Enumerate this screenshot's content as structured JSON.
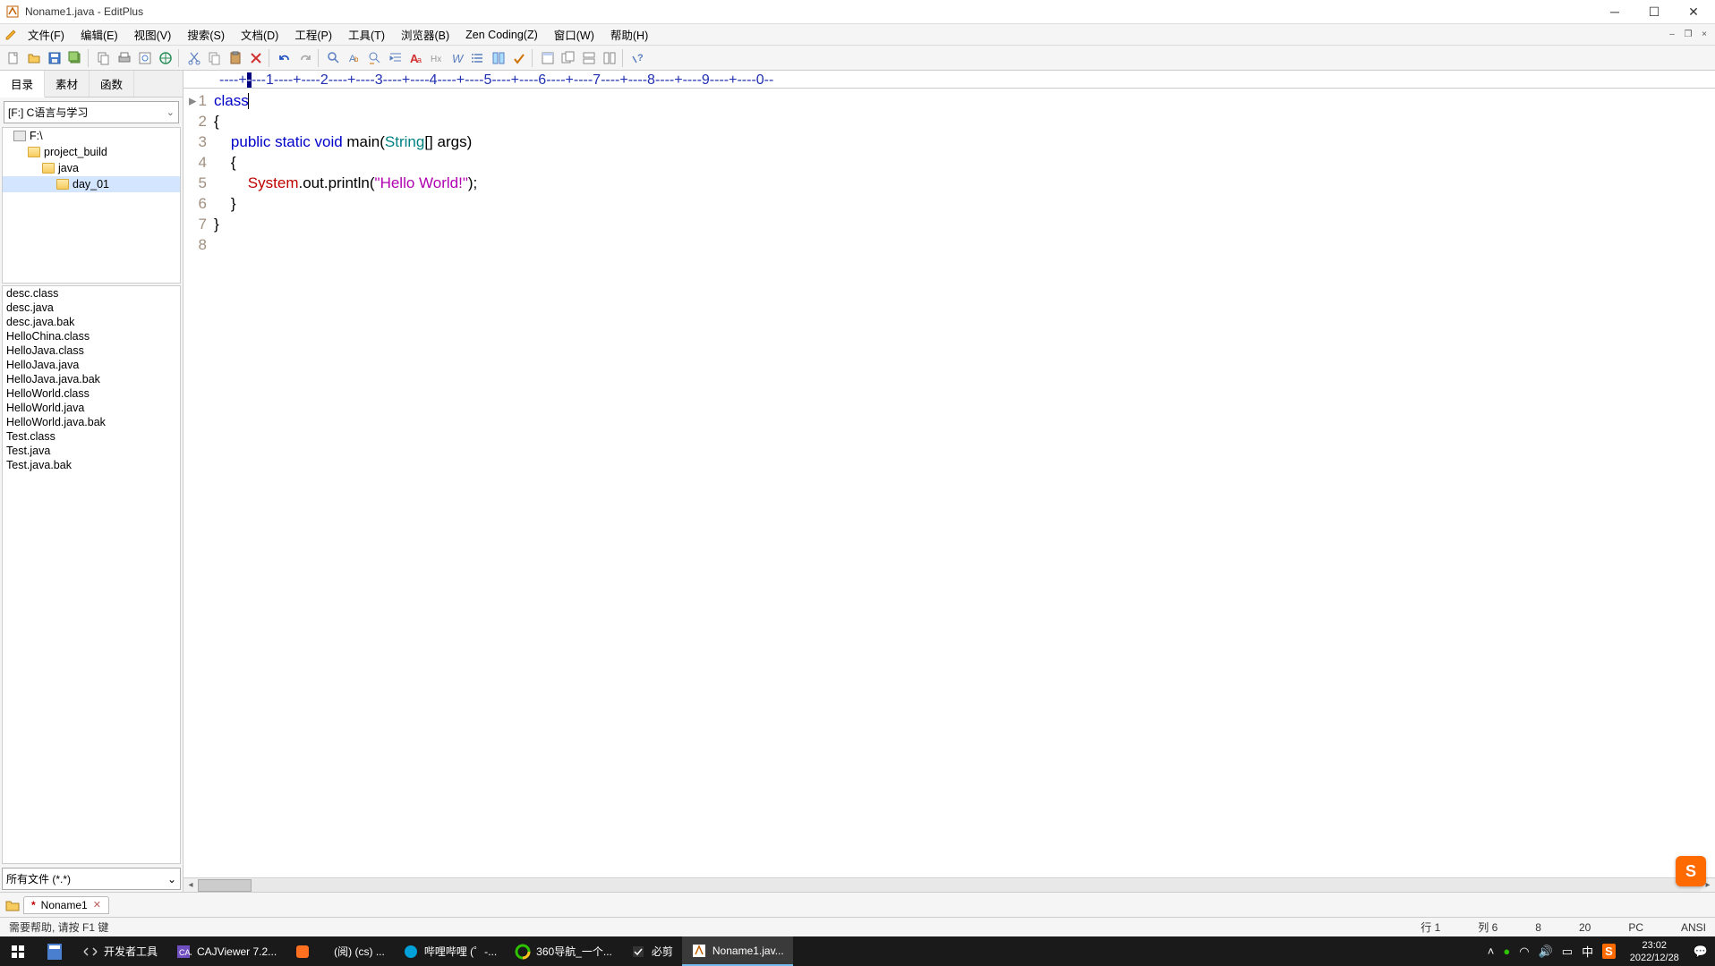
{
  "window": {
    "title": "Noname1.java - EditPlus"
  },
  "menu": {
    "file": "文件(F)",
    "edit": "编辑(E)",
    "view": "视图(V)",
    "search": "搜索(S)",
    "document": "文档(D)",
    "project": "工程(P)",
    "tools": "工具(T)",
    "browser": "浏览器(B)",
    "zen": "Zen Coding(Z)",
    "window": "窗口(W)",
    "help": "帮助(H)"
  },
  "sidebar": {
    "tabs": {
      "dir": "目录",
      "clip": "素材",
      "func": "函数"
    },
    "drive_label": "[F:] C语言与学习",
    "tree": [
      {
        "label": "F:\\",
        "indent": 0,
        "type": "drive"
      },
      {
        "label": "project_build",
        "indent": 1,
        "type": "folder"
      },
      {
        "label": "java",
        "indent": 2,
        "type": "folder"
      },
      {
        "label": "day_01",
        "indent": 3,
        "type": "folder",
        "selected": true
      }
    ],
    "files": [
      "desc.class",
      "desc.java",
      "desc.java.bak",
      "HelloChina.class",
      "HelloJava.class",
      "HelloJava.java",
      "HelloJava.java.bak",
      "HelloWorld.class",
      "HelloWorld.java",
      "HelloWorld.java.bak",
      "Test.class",
      "Test.java",
      "Test.java.bak"
    ],
    "filter": "所有文件 (*.*)"
  },
  "ruler": {
    "pre": "----+",
    "mark": "-",
    "post": "---1----+----2----+----3----+----4----+----5----+----6----+----7----+----8----+----9----+----0--"
  },
  "code": {
    "lines": [
      {
        "n": "1",
        "html": "<span class=\"kw\">class</span><span class=\"text-cursor\"></span>"
      },
      {
        "n": "2",
        "html": "{"
      },
      {
        "n": "3",
        "html": "    <span class=\"kw\">public</span> <span class=\"kw\">static</span> <span class=\"kw\">void</span> main(<span class=\"type\">String</span>[] args)"
      },
      {
        "n": "4",
        "html": "    {"
      },
      {
        "n": "5",
        "html": "        <span class=\"cls\">System</span>.out.println(<span class=\"str\">\"Hello World!\"</span>);"
      },
      {
        "n": "6",
        "html": "    }"
      },
      {
        "n": "7",
        "html": "}"
      },
      {
        "n": "8",
        "html": ""
      }
    ]
  },
  "doc_tab": {
    "name": "Noname1",
    "modified": "*"
  },
  "status": {
    "help": "需要帮助, 请按 F1 键",
    "line": "行 1",
    "col": "列 6",
    "num1": "8",
    "num2": "20",
    "mode": "PC",
    "encoding": "ANSI"
  },
  "taskbar": {
    "items": [
      {
        "icon": "dev",
        "label": "开发者工具"
      },
      {
        "icon": "caj",
        "label": "CAJViewer 7.2..."
      },
      {
        "icon": "orange",
        "label": ""
      },
      {
        "icon": "read",
        "label": "(阅)  (cs) ..."
      },
      {
        "icon": "bili",
        "label": "哔哩哔哩 (゜-..."
      },
      {
        "icon": "360",
        "label": "360导航_一个..."
      },
      {
        "icon": "cut",
        "label": "必剪"
      },
      {
        "icon": "editplus",
        "label": "Noname1.jav...",
        "active": true
      }
    ],
    "clock": {
      "time": "23:02",
      "date": "2022/12/28"
    }
  }
}
